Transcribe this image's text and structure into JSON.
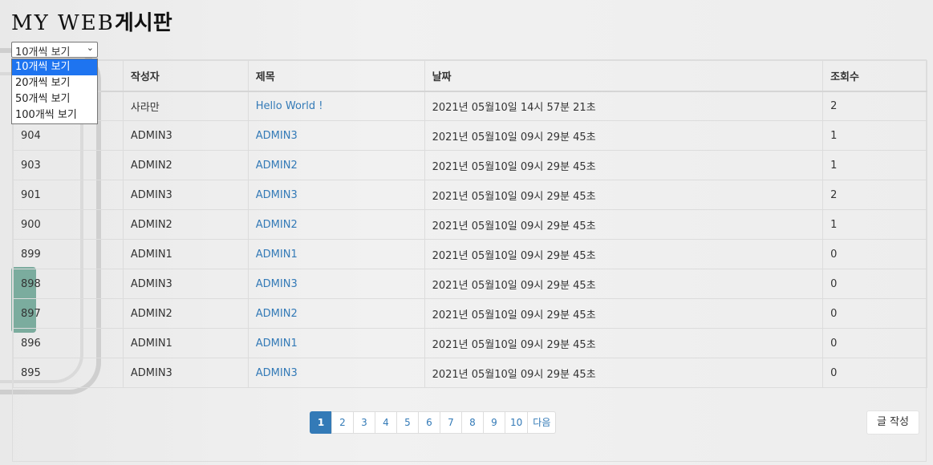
{
  "header": {
    "title_latin": "MY WEB",
    "title_korean": "게시판"
  },
  "page_size": {
    "selected": "10개씩 보기",
    "options": [
      "10개씩 보기",
      "20개씩 보기",
      "50개씩 보기",
      "100개씩 보기"
    ]
  },
  "table": {
    "columns": [
      "",
      "작성자",
      "제목",
      "날짜",
      "조회수"
    ],
    "rows": [
      {
        "num": "",
        "author": "사라만",
        "title": "Hello World !",
        "date": "2021년 05월10일 14시 57분 21초",
        "views": "2"
      },
      {
        "num": "904",
        "author": "ADMIN3",
        "title": "ADMIN3",
        "date": "2021년 05월10일 09시 29분 45초",
        "views": "1"
      },
      {
        "num": "903",
        "author": "ADMIN2",
        "title": "ADMIN2",
        "date": "2021년 05월10일 09시 29분 45초",
        "views": "1"
      },
      {
        "num": "901",
        "author": "ADMIN3",
        "title": "ADMIN3",
        "date": "2021년 05월10일 09시 29분 45초",
        "views": "2"
      },
      {
        "num": "900",
        "author": "ADMIN2",
        "title": "ADMIN2",
        "date": "2021년 05월10일 09시 29분 45초",
        "views": "1"
      },
      {
        "num": "899",
        "author": "ADMIN1",
        "title": "ADMIN1",
        "date": "2021년 05월10일 09시 29분 45초",
        "views": "0"
      },
      {
        "num": "898",
        "author": "ADMIN3",
        "title": "ADMIN3",
        "date": "2021년 05월10일 09시 29분 45초",
        "views": "0"
      },
      {
        "num": "897",
        "author": "ADMIN2",
        "title": "ADMIN2",
        "date": "2021년 05월10일 09시 29분 45초",
        "views": "0"
      },
      {
        "num": "896",
        "author": "ADMIN1",
        "title": "ADMIN1",
        "date": "2021년 05월10일 09시 29분 45초",
        "views": "0"
      },
      {
        "num": "895",
        "author": "ADMIN3",
        "title": "ADMIN3",
        "date": "2021년 05월10일 09시 29분 45초",
        "views": "0"
      }
    ]
  },
  "pagination": {
    "pages": [
      "1",
      "2",
      "3",
      "4",
      "5",
      "6",
      "7",
      "8",
      "9",
      "10"
    ],
    "active": "1",
    "next_label": "다음"
  },
  "write_button": "글 작성",
  "colors": {
    "link": "#337ab7",
    "active_page": "#337ab7",
    "select_highlight": "#1e74f0"
  },
  "icons": {
    "select_arrow": "chevron-down-icon"
  }
}
